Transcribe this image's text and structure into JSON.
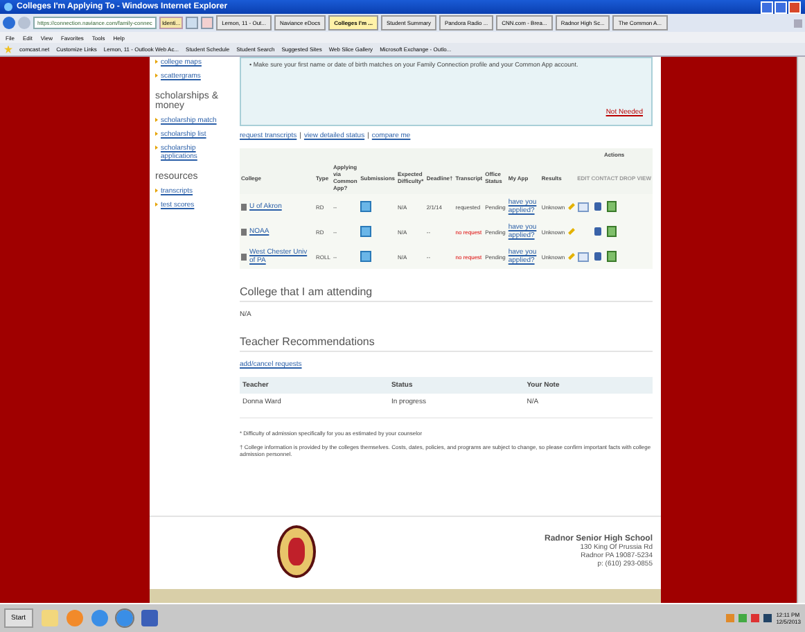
{
  "window": {
    "title": "Colleges I'm Applying To - Windows Internet Explorer"
  },
  "address_bar": {
    "url": "https://connection.naviance.com/family-connec",
    "security": "Identi..."
  },
  "browser_tabs": [
    {
      "label": "Lemon, 11 - Out...",
      "selected": false
    },
    {
      "label": "Naviance eDocs",
      "selected": false
    },
    {
      "label": "Colleges I'm ...",
      "selected": true
    },
    {
      "label": "Student Summary",
      "selected": false
    },
    {
      "label": "Pandora Radio ...",
      "selected": false
    },
    {
      "label": "CNN.com - Brea...",
      "selected": false
    },
    {
      "label": "Radnor High Sc...",
      "selected": false
    },
    {
      "label": "The Common A...",
      "selected": false
    }
  ],
  "menu_bar": [
    "File",
    "Edit",
    "View",
    "Favorites",
    "Tools",
    "Help"
  ],
  "favorites": [
    "comcast.net",
    "Customize Links",
    "Lemon, 11 - Outlook Web Ac...",
    "Student Schedule",
    "Student Search",
    "Suggested Sites",
    "Web Slice Gallery",
    "Microsoft Exchange - Outlo..."
  ],
  "sidebar": {
    "groups": [
      {
        "items": [
          "college maps",
          "scattergrams"
        ]
      },
      {
        "heading": "scholarships & money",
        "items": [
          "scholarship match",
          "scholarship list",
          "scholarship applications"
        ]
      },
      {
        "heading": "resources",
        "items": [
          "transcripts",
          "test scores"
        ]
      }
    ]
  },
  "notice": {
    "text": "• Make sure your first name or date of birth matches on your Family Connection profile and your Common App account.",
    "link": "Not Needed"
  },
  "links": {
    "separator": "|",
    "items": [
      "request transcripts",
      "view detailed status",
      "compare me"
    ]
  },
  "colleges_table": {
    "actions_heading": "Actions",
    "actions_sub": "EDIT CONTACT DROP VIEW",
    "columns": [
      "College",
      "Type",
      "Applying via Common App?",
      "Submissions",
      "Expected Difficulty*",
      "Deadline†",
      "Transcript",
      "Office Status",
      "My App",
      "Results"
    ],
    "rows": [
      {
        "college": "U of Akron",
        "type": "RD",
        "common_app": "--",
        "difficulty": "N/A",
        "deadline": "2/1/14",
        "transcript": "requested",
        "transcript_requested": true,
        "office_status": "Pending",
        "my_app": "have you applied?",
        "results": "Unknown",
        "contact": true
      },
      {
        "college": "NOAA",
        "type": "RD",
        "common_app": "--",
        "difficulty": "N/A",
        "deadline": "--",
        "transcript": "no request",
        "transcript_requested": false,
        "office_status": "Pending",
        "my_app": "have you applied?",
        "results": "Unknown",
        "contact": false
      },
      {
        "college": "West Chester Univ of PA",
        "type": "ROLL",
        "common_app": "--",
        "difficulty": "N/A",
        "deadline": "--",
        "transcript": "no request",
        "transcript_requested": false,
        "office_status": "Pending",
        "my_app": "have you applied?",
        "results": "Unknown",
        "contact": true
      }
    ]
  },
  "attending": {
    "heading": "College that I am attending",
    "value": "N/A"
  },
  "recommendations": {
    "heading": "Teacher Recommendations",
    "link": "add/cancel requests",
    "columns": [
      "Teacher",
      "Status",
      "Your Note"
    ],
    "rows": [
      {
        "teacher": "Donna Ward",
        "status": "In progress",
        "note": "N/A"
      }
    ]
  },
  "footnotes": [
    "* Difficulty of admission specifically for you as estimated by your counselor",
    "† College information is provided by the colleges themselves. Costs, dates, policies, and programs are subject to change, so please confirm important facts with college admission personnel."
  ],
  "footer": {
    "school": "Radnor Senior High School",
    "address": [
      "130 King Of Prussia Rd",
      "Radnor PA 19087-5234",
      "p: (610) 293-0855"
    ]
  },
  "taskbar": {
    "start": "Start",
    "time": "12:11 PM",
    "date": "12/5/2013"
  }
}
